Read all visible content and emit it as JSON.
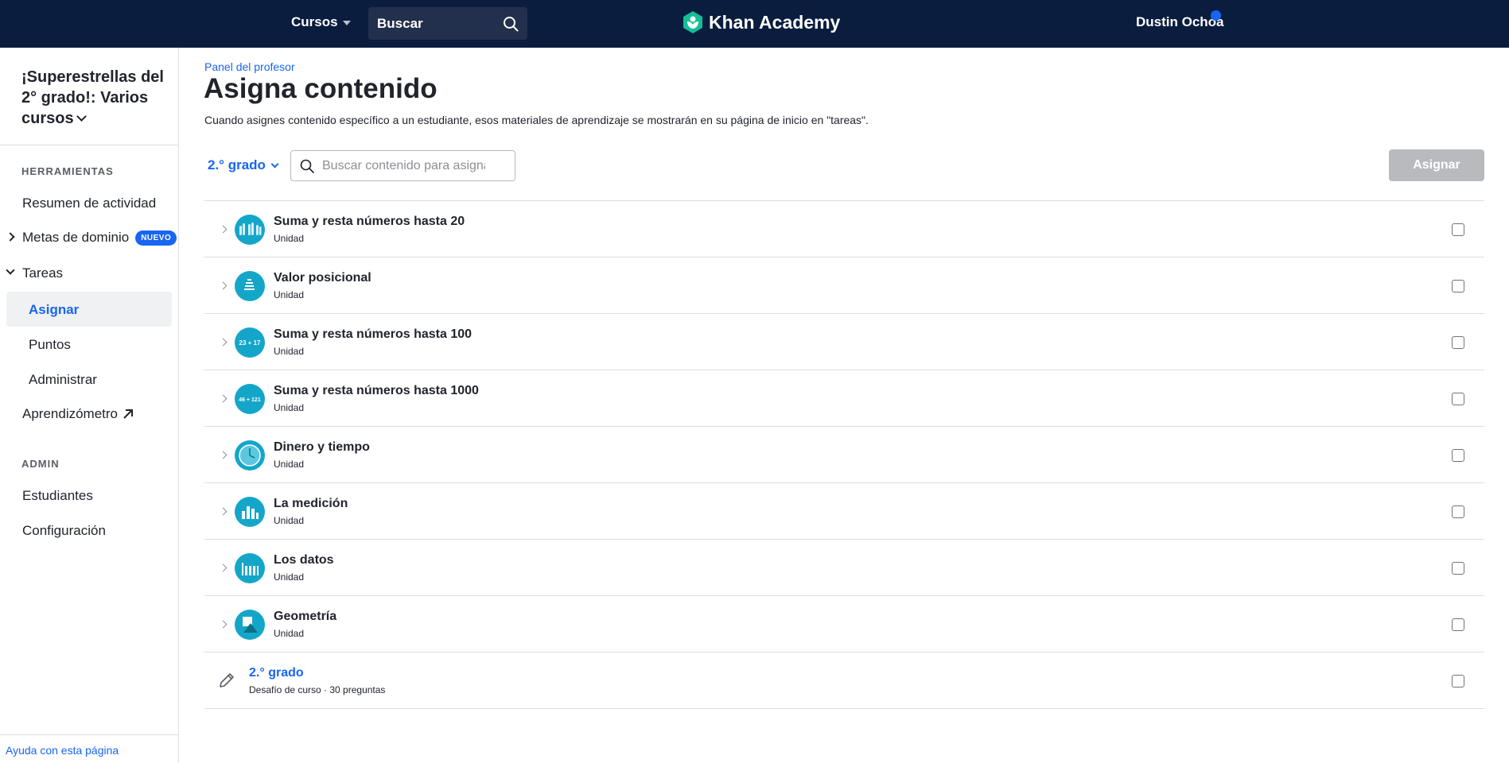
{
  "topnav": {
    "courses_label": "Cursos",
    "search_placeholder": "Buscar",
    "logo_text": "Khan Academy",
    "user_name": "Dustin Ochoa"
  },
  "sidebar": {
    "class_title": "¡Superestrellas del 2° grado!: Varios cursos",
    "tools_heading": "HERRAMIENTAS",
    "items": {
      "activity": "Resumen de actividad",
      "mastery": "Metas de dominio",
      "mastery_badge": "NUEVO",
      "tasks": "Tareas",
      "assign": "Asignar",
      "points": "Puntos",
      "manage": "Administrar",
      "learning_meter": "Aprendizómetro"
    },
    "admin_heading": "ADMIN",
    "admin_items": {
      "students": "Estudiantes",
      "settings": "Configuración"
    },
    "help_link": "Ayuda con esta página"
  },
  "main": {
    "breadcrumb": "Panel del profesor",
    "title": "Asigna contenido",
    "description": "Cuando asignes contenido específico a un estudiante, esos materiales de aprendizaje se mostrarán en su página de inicio en \"tareas\".",
    "grade_select": "2.° grado",
    "search_placeholder": "Buscar contenido para asignar",
    "assign_button": "Asignar",
    "units": [
      {
        "title": "Suma y resta números hasta 20",
        "type": "Unidad",
        "icon": "fingers-icon"
      },
      {
        "title": "Valor posicional",
        "type": "Unidad",
        "icon": "place-value-icon"
      },
      {
        "title": "Suma y resta números hasta 100",
        "type": "Unidad",
        "icon": "sum-23-17-icon",
        "icon_text": "23 + 17"
      },
      {
        "title": "Suma y resta números hasta 1000",
        "type": "Unidad",
        "icon": "sum-46-121-icon",
        "icon_text": "46 + 121"
      },
      {
        "title": "Dinero y tiempo",
        "type": "Unidad",
        "icon": "clock-icon"
      },
      {
        "title": "La medición",
        "type": "Unidad",
        "icon": "measurement-icon"
      },
      {
        "title": "Los datos",
        "type": "Unidad",
        "icon": "data-icon"
      },
      {
        "title": "Geometría",
        "type": "Unidad",
        "icon": "geometry-icon"
      }
    ],
    "course_challenge": {
      "title": "2.° grado",
      "subtitle": "Desafío de curso · 30 preguntas"
    }
  },
  "colors": {
    "nav_bg": "#0a1d3f",
    "link_blue": "#1865f2",
    "unit_icon": "#14a6c9",
    "disabled_button": "#b9babd"
  }
}
